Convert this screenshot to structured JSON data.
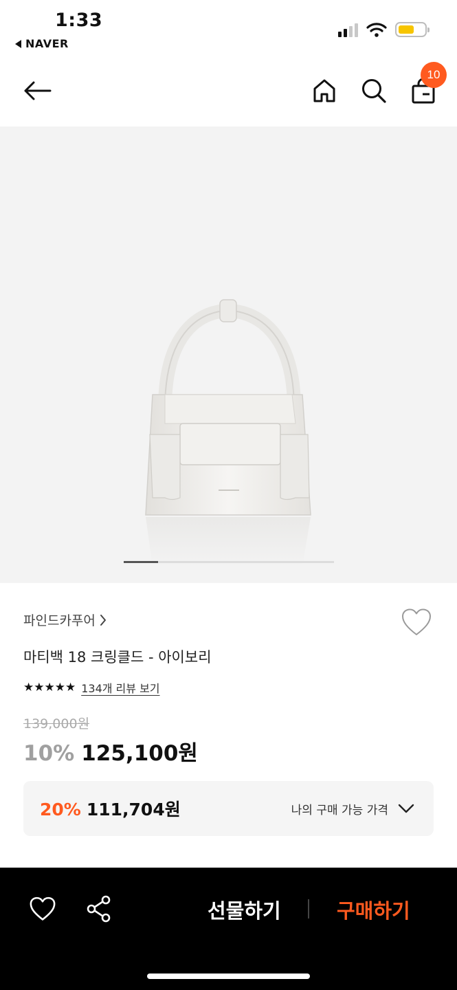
{
  "status": {
    "time": "1:33",
    "back_app": "NAVER"
  },
  "nav": {
    "cart_count": "10"
  },
  "product": {
    "brand": "파인드카푸어",
    "title": "마티백 18 크링클드 - 아이보리",
    "stars": "★★★★★",
    "review_link": "134개 리뷰 보기",
    "original_price": "139,000원",
    "discount": "10%",
    "price": "125,100원"
  },
  "member_offer": {
    "discount": "20%",
    "price": "111,704원",
    "label": "나의 구매 가능 가격"
  },
  "bottom": {
    "gift_label": "선물하기",
    "buy_label": "구매하기"
  },
  "colors": {
    "accent": "#ff5a1f",
    "battery": "#f7c500"
  },
  "icons": [
    "back-arrow-icon",
    "home-icon",
    "search-icon",
    "shopping-bag-icon",
    "heart-icon",
    "share-icon",
    "chevron-down-icon",
    "chevron-right-icon"
  ]
}
